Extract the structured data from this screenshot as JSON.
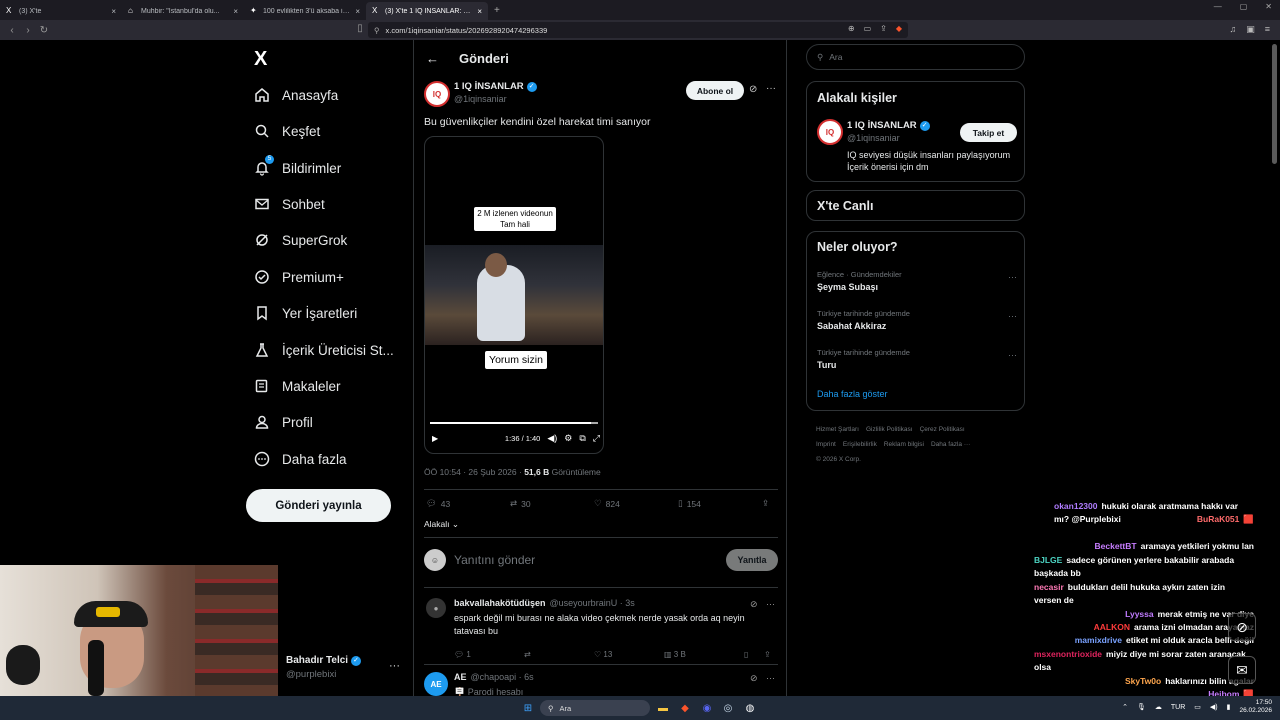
{
  "browser": {
    "tabs": [
      {
        "icon": "X",
        "title": "(3) X'te",
        "active": false
      },
      {
        "icon": "⌂",
        "title": "Muhbir: \"İstanbul'da olu...",
        "active": false
      },
      {
        "icon": "✦",
        "title": "100 evlilikten 3'ü aksaba ile! En yüksek...",
        "active": false
      },
      {
        "icon": "X",
        "title": "(3) X'te 1 IQ İNSANLAR: \"Bu güv...",
        "active": true
      }
    ],
    "url": "x.com/1iqinsaniar/status/2026928920474296339"
  },
  "sidebar": {
    "logo": "X",
    "items": [
      {
        "label": "Anasayfa",
        "icon": "home-icon"
      },
      {
        "label": "Keşfet",
        "icon": "search-icon"
      },
      {
        "label": "Bildirimler",
        "icon": "bell-icon",
        "badge": "5"
      },
      {
        "label": "Sohbet",
        "icon": "mail-icon"
      },
      {
        "label": "SuperGrok",
        "icon": "grok-icon"
      },
      {
        "label": "Premium+",
        "icon": "premium-icon"
      },
      {
        "label": "Yer İşaretleri",
        "icon": "bookmark-icon"
      },
      {
        "label": "İçerik Üreticisi St...",
        "icon": "flask-icon"
      },
      {
        "label": "Makaleler",
        "icon": "article-icon"
      },
      {
        "label": "Profil",
        "icon": "profile-icon"
      },
      {
        "label": "Daha fazla",
        "icon": "more-circle-icon"
      }
    ],
    "post_button": "Gönderi yayınla",
    "account": {
      "name": "Bahadır Telci",
      "handle": "@purplebixi"
    }
  },
  "main": {
    "title": "Gönderi",
    "post": {
      "author_name": "1 IQ İNSANLAR",
      "author_handle": "@1iqinsaniar",
      "subscribe_label": "Abone ol",
      "text": "Bu güvenlikçiler kendini özel harekat timi sanıyor",
      "video": {
        "caption_top_1": "2 M izlenen videonun",
        "caption_top_2": "Tam hali",
        "caption_bottom": "Yorum sizin",
        "time": "1:36 / 1:40",
        "progress": 0.96
      },
      "timestamp": "ÖÖ 10:54 · 26 Şub 2026 · ",
      "views_count": "51,6 B",
      "views_label": " Görüntüleme",
      "stats": {
        "replies": "43",
        "reposts": "30",
        "likes": "824",
        "bookmarks": "154"
      },
      "related_label": "Alakalı"
    },
    "reply_box": {
      "placeholder": "Yanıtını gönder",
      "button": "Yanıtla"
    },
    "comments": [
      {
        "name": "bakvallahakötüdüşen",
        "handle": "@useyourbrainU · 3s",
        "text": "espark değil mi burası ne alaka video çekmek nerde yasak orda aq neyin tatavası bu",
        "replies": "1",
        "reposts": "",
        "likes": "13",
        "views": "3 B"
      },
      {
        "name": "AE",
        "handle": "@chapoapi · 6s",
        "text": "🪧 Parodi hesabı"
      }
    ]
  },
  "right": {
    "search_placeholder": "Ara",
    "relevant": {
      "title": "Alakalı kişiler",
      "name": "1 IQ İNSANLAR",
      "handle": "@1iqinsaniar",
      "bio": "IQ seviyesi düşük insanları paylaşıyorum İçerik önerisi için dm",
      "follow": "Takip et"
    },
    "live_title": "X'te Canlı",
    "trends": {
      "title": "Neler oluyor?",
      "items": [
        {
          "context": "Eğlence · Gündemdekiler",
          "title": "Şeyma Subaşı"
        },
        {
          "context": "Türkiye tarihinde gündemde",
          "title": "Sabahat Akkiraz"
        },
        {
          "context": "Türkiye tarihinde gündemde",
          "title": "Turu"
        }
      ],
      "show_more": "Daha fazla göster"
    },
    "footer": [
      "Hizmet Şartları",
      "Gizlilik Politikası",
      "Çerez Politikası",
      "Imprint",
      "Erişilebilirlik",
      "Reklam bilgisi",
      "Daha fazla ···",
      "© 2026 X Corp."
    ]
  },
  "chat": [
    {
      "user": "okan12300",
      "color": "#b07cff",
      "text": "hukuki olarak aratmama hakkı var mı? @Purplebixi"
    },
    {
      "user": "BuRaK051",
      "color": "#ff6b6b",
      "text": "🟥"
    },
    {
      "user": "BeckettBT",
      "color": "#c77dff",
      "text": "aramaya yetkileri yokmu lan"
    },
    {
      "user": "BJLGE",
      "color": "#4cd3c2",
      "text": "sadece görünen yerlere bakabilir arabada başkada bb"
    },
    {
      "user": "necasir",
      "color": "#ff7ab6",
      "text": "buldukları delil hukuka aykırı zaten izin versen de"
    },
    {
      "user": "Lyyssa",
      "color": "#c07cff",
      "text": "merak etmiş ne var diye"
    },
    {
      "user": "AALKON",
      "color": "#ff3b3b",
      "text": "arama izni olmadan arayamaz"
    },
    {
      "user": "mamixdrive",
      "color": "#7aa2ff",
      "text": "etiket mi olduk aracla belli değil"
    },
    {
      "user": "msxenontrioxide",
      "color": "#e0245e",
      "text": "miyiz diye mi sorar zaten aranacak olsa"
    },
    {
      "user": "SkyTw0o",
      "color": "#ffa64d",
      "text": "haklarınızı bilin agalar"
    },
    {
      "user": "Heibom",
      "color": "#c77dff",
      "text": "🟥"
    }
  ],
  "taskbar": {
    "search": "Ara",
    "lang": "TUR",
    "time": "17:50",
    "date": "26.02.2026"
  },
  "colors": {
    "accent": "#1d9bf0",
    "background": "#000000",
    "border": "#2f3336",
    "muted": "#71767b",
    "link": "#1d9bf0"
  }
}
